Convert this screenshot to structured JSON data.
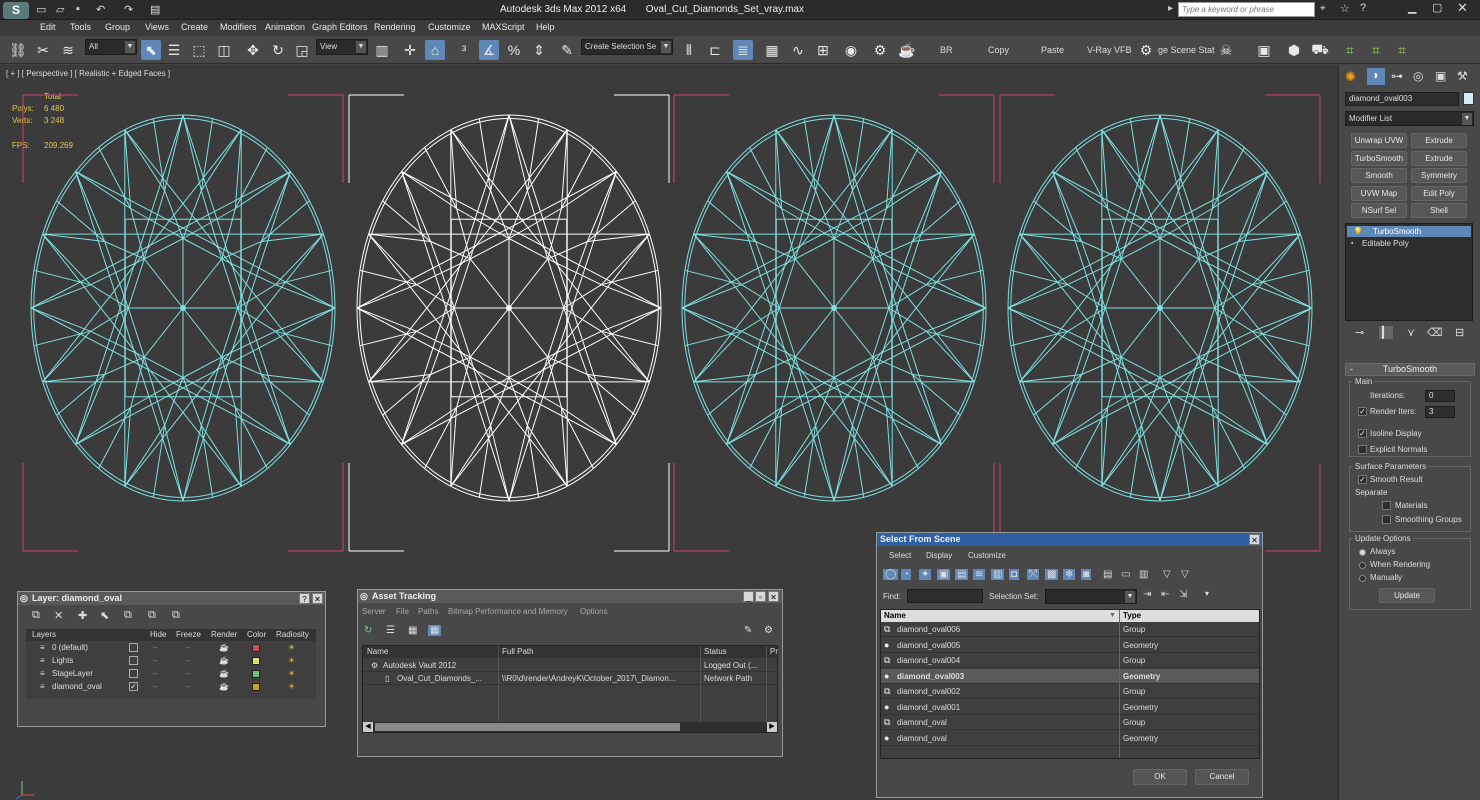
{
  "titlebar": {
    "app_title": "Autodesk 3ds Max  2012 x64",
    "file_name": "Oval_Cut_Diamonds_Set_vray.max",
    "search_placeholder": "Type a keyword or phrase"
  },
  "menu": [
    "Edit",
    "Tools",
    "Group",
    "Views",
    "Create",
    "Modifiers",
    "Animation",
    "Graph Editors",
    "Rendering",
    "Customize",
    "MAXScript",
    "Help"
  ],
  "toolbar": {
    "filter_value": "All",
    "view_value": "View",
    "selection_set_value": "Create Selection Se",
    "br_label": "BR",
    "copy_label": "Copy",
    "paste_label": "Paste",
    "vray_label": "V-Ray VFB",
    "scene_state_label": "ge Scene Stat"
  },
  "viewport": {
    "label": "[ + ] [ Perspective ] [ Realistic + Edged Faces ]",
    "stats": {
      "total_label": "Total",
      "polys_label": "Polys:",
      "polys_value": "6 480",
      "verts_label": "Verts:",
      "verts_value": "3 248",
      "fps_label": "FPS:",
      "fps_value": "209.269"
    }
  },
  "command_panel": {
    "object_name": "diamond_oval003",
    "modifier_list": "Modifier List",
    "modifier_buttons": [
      "Unwrap UVW",
      "Extrude",
      "TurboSmooth",
      "Extrude",
      "Smooth",
      "Symmetry",
      "UVW Map",
      "Edit Poly",
      "NSurf Sel",
      "Shell"
    ],
    "stack": [
      "TurboSmooth",
      "Editable Poly"
    ],
    "rollout_title": "TurboSmooth",
    "main_group": "Main",
    "iterations_label": "Iterations:",
    "iterations_value": "0",
    "render_iters_label": "Render Iters:",
    "render_iters_value": "3",
    "isoline_label": "Isoline Display",
    "explicit_normals_label": "Explicit Normals",
    "surface_group": "Surface Parameters",
    "smooth_result_label": "Smooth Result",
    "separate_label": "Separate",
    "materials_label": "Materials",
    "smoothing_groups_label": "Smoothing Groups",
    "update_group": "Update Options",
    "always_label": "Always",
    "when_rendering_label": "When Rendering",
    "manually_label": "Manually",
    "update_button": "Update"
  },
  "layer_panel": {
    "title": "Layer: diamond_oval",
    "columns": [
      "Layers",
      "Hide",
      "Freeze",
      "Render",
      "Color",
      "Radiosity"
    ],
    "rows": [
      {
        "name": "0 (default)",
        "color": "#c85050",
        "checked": false
      },
      {
        "name": "Lights",
        "color": "#e0e070",
        "checked": false
      },
      {
        "name": "StageLayer",
        "color": "#70c070",
        "checked": false
      },
      {
        "name": "diamond_oval",
        "color": "#d0a020",
        "checked": true
      }
    ]
  },
  "asset_panel": {
    "title": "Asset Tracking",
    "menu": [
      "Server",
      "File",
      "Paths",
      "Bitmap Performance and Memory",
      "Options"
    ],
    "columns": [
      "Name",
      "Full Path",
      "Status",
      "Pr"
    ],
    "rows": [
      {
        "name": "Autodesk Vault 2012",
        "path": "",
        "status": "Logged Out (..."
      },
      {
        "name": "Oval_Cut_Diamonds_...",
        "path": "\\\\R0\\d\\render\\AndreyK\\October_2017\\_Diamon...",
        "status": "Network Path"
      }
    ]
  },
  "select_panel": {
    "title": "Select From Scene",
    "menu": [
      "Select",
      "Display",
      "Customize"
    ],
    "find_label": "Find:",
    "selection_set_label": "Selection Set:",
    "columns": [
      "Name",
      "Type"
    ],
    "rows": [
      {
        "name": "diamond_oval006",
        "type": "Group",
        "selected": false
      },
      {
        "name": "diamond_oval005",
        "type": "Geometry",
        "selected": false
      },
      {
        "name": "diamond_oval004",
        "type": "Group",
        "selected": false
      },
      {
        "name": "diamond_oval003",
        "type": "Geometry",
        "selected": true
      },
      {
        "name": "diamond_oval002",
        "type": "Group",
        "selected": false
      },
      {
        "name": "diamond_oval001",
        "type": "Geometry",
        "selected": false
      },
      {
        "name": "diamond_oval",
        "type": "Group",
        "selected": false
      },
      {
        "name": "diamond_oval",
        "type": "Geometry",
        "selected": false
      }
    ],
    "ok_label": "OK",
    "cancel_label": "Cancel"
  },
  "colors": {
    "wire_cyan": "#7fe0e0",
    "wire_white": "#ffffff",
    "bbox_pink": "#d04070",
    "hud_yellow": "#e2c84a",
    "selection_blue": "#5f88b8"
  }
}
